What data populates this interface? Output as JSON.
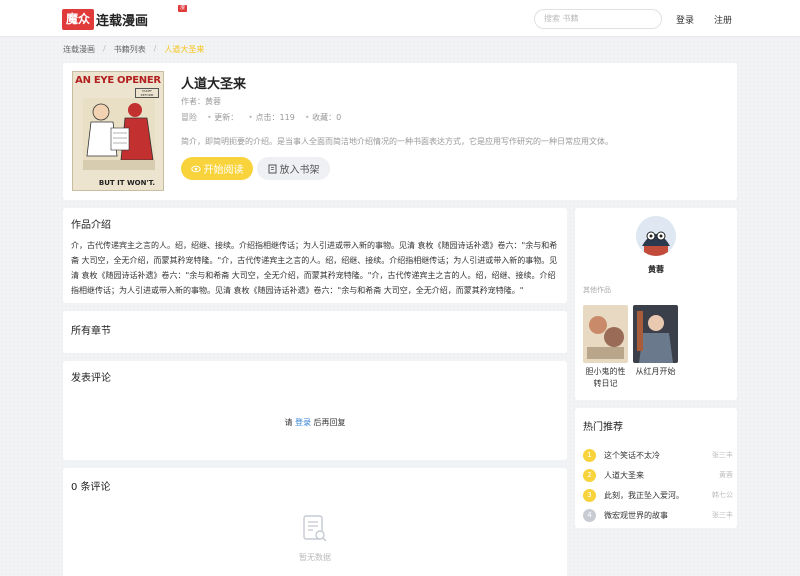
{
  "header": {
    "logo_mark": "魔众",
    "logo_text": "连载漫画",
    "logo_badge": "漫画",
    "search_placeholder": "搜索 书籍",
    "login": "登录",
    "register": "注册"
  },
  "breadcrumb": [
    "连载漫画",
    "书籍列表",
    "人道大圣来"
  ],
  "book": {
    "title": "人道大圣来",
    "author_label": "作者：",
    "author": "黄蓉",
    "category": "冒险",
    "update_label": "更新：",
    "update_value": "",
    "clicks_label": "点击：",
    "clicks": "119",
    "favorites_label": "收藏：",
    "favorites": "0",
    "intro": "简介，即简明扼要的介绍。是当事人全面而简洁地介绍情况的一种书面表达方式，它是应用写作研究的一种日常应用文体。",
    "cover_title": "AN EYE OPENER",
    "cover_sub": "TARIFF REFORM",
    "cover_bottom": "BUT IT WON'T.",
    "read_button": "开始阅读",
    "shelf_button": "放入书架"
  },
  "sections": {
    "intro_title": "作品介绍",
    "intro_text": "介，古代传递宾主之言的人。绍，绍继、接续。介绍指相继传话；为人引进或带入新的事物。见清 袁枚《随园诗话补遗》卷六：\"余与和希斋 大司空，全无介绍，而蒙其矜宠特隆。\"介，古代传递宾主之言的人。绍，绍继、接续。介绍指相继传话；为人引进或带入新的事物。见清 袁枚《随园诗话补遗》卷六：\"余与和希斋 大司空，全无介绍，而蒙其矜宠特隆。\"介，古代传递宾主之言的人。绍，绍继、接续。介绍指相继传话；为人引进或带入新的事物。见清 袁枚《随园诗话补遗》卷六：\"余与和希斋 大司空，全无介绍，而蒙其矜宠特隆。\"",
    "chapters_title": "所有章节",
    "comment_title": "发表评论",
    "comment_prompt_pre": "请",
    "comment_prompt_link": "登录",
    "comment_prompt_post": "后再回复",
    "comments_count_title": "0 条评论",
    "empty_text": "暂无数据"
  },
  "author_panel": {
    "name": "黄蓉",
    "other_works_label": "其他作品",
    "works": [
      {
        "name": "胆小鬼的性转日记"
      },
      {
        "name": "从红月开始"
      }
    ]
  },
  "hot": {
    "title": "热门推荐",
    "items": [
      {
        "rank": "1",
        "name": "这个笑话不太冷",
        "author": "张三丰"
      },
      {
        "rank": "2",
        "name": "人道大圣来",
        "author": "黄蓉"
      },
      {
        "rank": "3",
        "name": "此刻，我正坠入爱河。",
        "author": "韩七公"
      },
      {
        "rank": "4",
        "name": "微宏观世界的故事",
        "author": "张三丰"
      }
    ]
  },
  "colors": {
    "accent_yellow": "#f8d33c",
    "brand_red": "#e03a3a",
    "link_blue": "#2f7fd6"
  }
}
